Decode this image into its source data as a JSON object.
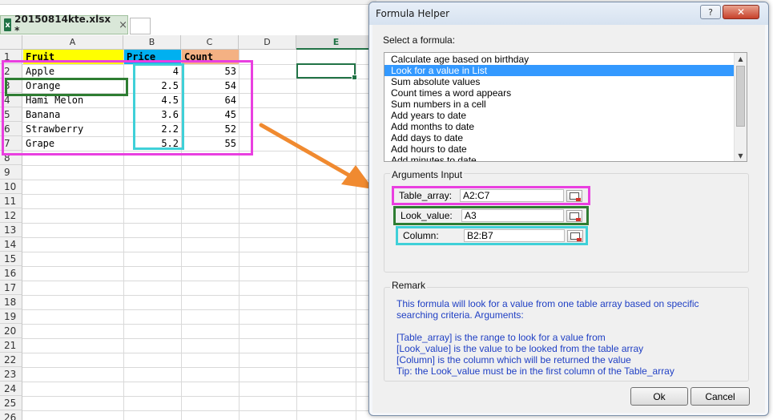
{
  "workbook": {
    "tab_title": "20150814kte.xlsx *",
    "tab_close": "×",
    "excel_icon_letter": "x",
    "columns": [
      "A",
      "B",
      "C",
      "D",
      "E"
    ],
    "active_column": "E",
    "rows": [
      "1",
      "2",
      "3",
      "4",
      "5",
      "6",
      "7",
      "8",
      "9",
      "10",
      "11",
      "12",
      "13",
      "14",
      "15",
      "16",
      "17",
      "18",
      "19",
      "20",
      "21",
      "22",
      "23",
      "24",
      "25",
      "26"
    ],
    "headers": {
      "fruit": "Fruit",
      "price": "Price",
      "count": "Count"
    },
    "data": [
      {
        "fruit": "Apple",
        "price": "4",
        "count": "53"
      },
      {
        "fruit": "Orange",
        "price": "2.5",
        "count": "54"
      },
      {
        "fruit": "Hami Melon",
        "price": "4.5",
        "count": "64"
      },
      {
        "fruit": "Banana",
        "price": "3.6",
        "count": "45"
      },
      {
        "fruit": "Strawberry",
        "price": "2.2",
        "count": "52"
      },
      {
        "fruit": "Grape",
        "price": "5.2",
        "count": "55"
      }
    ]
  },
  "colors": {
    "magenta": "#e93fe0",
    "green": "#2e7d32",
    "cyan": "#3fd0d8",
    "arrow": "#f08a30"
  },
  "dialog": {
    "title": "Formula Helper",
    "help_label": "?",
    "close_label": "✕",
    "select_label": "Select a formula:",
    "formulas": [
      "Calculate age based on birthday",
      "Look for a value in List",
      "Sum absolute values",
      "Count times a word appears",
      "Sum numbers in a cell",
      "Add years to date",
      "Add months to date",
      "Add days to date",
      "Add hours to date",
      "Add minutes to date"
    ],
    "selected_index": 1,
    "arguments_label": "Arguments Input",
    "args": [
      {
        "label": "Table_array:",
        "value": "A2:C7"
      },
      {
        "label": "Look_value:",
        "value": "A3"
      },
      {
        "label": "Column:",
        "value": "B2:B7"
      }
    ],
    "remark_label": "Remark",
    "remark_lines": [
      "This formula will look for a value from one table array based on specific",
      "searching criteria. Arguments:",
      "",
      "[Table_array] is the range to look for a value from",
      "[Look_value] is the value to be looked from the table array",
      "[Column] is the column which will be returned the value",
      "Tip: the Look_value must be in the first column of the Table_array"
    ],
    "ok_label": "Ok",
    "cancel_label": "Cancel"
  }
}
